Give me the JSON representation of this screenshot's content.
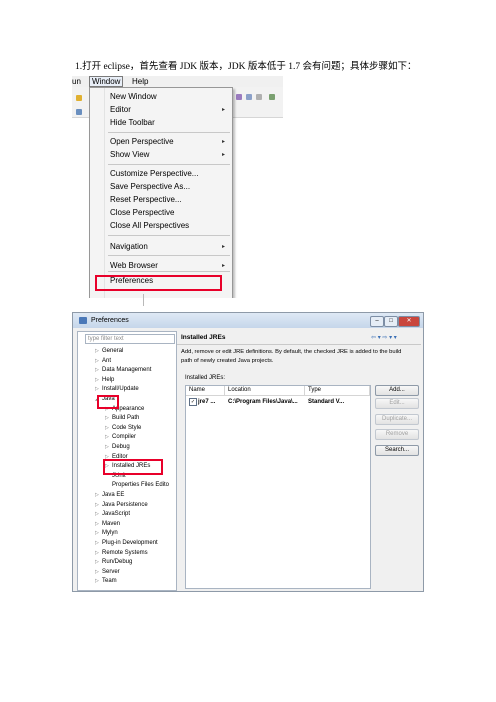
{
  "heading": "1.打开 eclipse，首先查看 JDK 版本，JDK 版本低于 1.7 会有问题；具体步骤如下：",
  "menubar": {
    "run": "un",
    "window": "Window",
    "help": "Help"
  },
  "window_menu": [
    {
      "label": "New Window",
      "arrow": false
    },
    {
      "label": "Editor",
      "arrow": true
    },
    {
      "label": "Hide Toolbar",
      "arrow": false
    },
    {
      "label": "Open Perspective",
      "arrow": true
    },
    {
      "label": "Show View",
      "arrow": true
    },
    {
      "label": "Customize Perspective...",
      "arrow": false
    },
    {
      "label": "Save Perspective As...",
      "arrow": false
    },
    {
      "label": "Reset Perspective...",
      "arrow": false
    },
    {
      "label": "Close Perspective",
      "arrow": false
    },
    {
      "label": "Close All Perspectives",
      "arrow": false
    },
    {
      "label": "Navigation",
      "arrow": true
    },
    {
      "label": "Web Browser",
      "arrow": true
    },
    {
      "label": "Preferences",
      "arrow": false
    }
  ],
  "submenu_arrow": "▸",
  "preferences": {
    "title": "Preferences",
    "filter_placeholder": "type filter text",
    "tree": [
      {
        "label": "General",
        "level": 0,
        "twisty": "▷"
      },
      {
        "label": "Ant",
        "level": 0,
        "twisty": "▷"
      },
      {
        "label": "Data Management",
        "level": 0,
        "twisty": "▷"
      },
      {
        "label": "Help",
        "level": 0,
        "twisty": "▷"
      },
      {
        "label": "Install/Update",
        "level": 0,
        "twisty": "▷"
      },
      {
        "label": "Java",
        "level": 0,
        "twisty": "◢"
      },
      {
        "label": "Appearance",
        "level": 1,
        "twisty": "▷"
      },
      {
        "label": "Build Path",
        "level": 1,
        "twisty": "▷"
      },
      {
        "label": "Code Style",
        "level": 1,
        "twisty": "▷"
      },
      {
        "label": "Compiler",
        "level": 1,
        "twisty": "▷"
      },
      {
        "label": "Debug",
        "level": 1,
        "twisty": "▷"
      },
      {
        "label": "Editor",
        "level": 1,
        "twisty": "▷"
      },
      {
        "label": "Installed JREs",
        "level": 1,
        "twisty": "▷"
      },
      {
        "label": "JUnit",
        "level": 1,
        "twisty": ""
      },
      {
        "label": "Properties Files Edito",
        "level": 1,
        "twisty": ""
      },
      {
        "label": "Java EE",
        "level": 0,
        "twisty": "▷"
      },
      {
        "label": "Java Persistence",
        "level": 0,
        "twisty": "▷"
      },
      {
        "label": "JavaScript",
        "level": 0,
        "twisty": "▷"
      },
      {
        "label": "Maven",
        "level": 0,
        "twisty": "▷"
      },
      {
        "label": "Mylyn",
        "level": 0,
        "twisty": "▷"
      },
      {
        "label": "Plug-in Development",
        "level": 0,
        "twisty": "▷"
      },
      {
        "label": "Remote Systems",
        "level": 0,
        "twisty": "▷"
      },
      {
        "label": "Run/Debug",
        "level": 0,
        "twisty": "▷"
      },
      {
        "label": "Server",
        "level": 0,
        "twisty": "▷"
      },
      {
        "label": "Team",
        "level": 0,
        "twisty": "▷"
      }
    ],
    "page_title": "Installed JREs",
    "nav": "⇦ ▾ ⇨ ▾ ▾",
    "description": "Add, remove or edit JRE definitions. By default, the checked JRE is added to the build path of newly created Java projects.",
    "installed_label": "Installed JREs:",
    "columns": [
      "Name",
      "Location",
      "Type"
    ],
    "row": {
      "checked": "✓",
      "name": "jre7 ...",
      "location": "C:\\Program Files\\Java\\...",
      "type": "Standard V..."
    },
    "buttons": [
      {
        "label": "Add...",
        "enabled": true
      },
      {
        "label": "Edit...",
        "enabled": false
      },
      {
        "label": "Duplicate...",
        "enabled": false
      },
      {
        "label": "Remove",
        "enabled": false
      },
      {
        "label": "Search...",
        "enabled": true
      }
    ],
    "window_buttons": {
      "min": "–",
      "max": "□",
      "close": "✕"
    }
  },
  "colors": {
    "highlight_box": "#e8002a",
    "title_gradient": "#c5d6ea"
  }
}
